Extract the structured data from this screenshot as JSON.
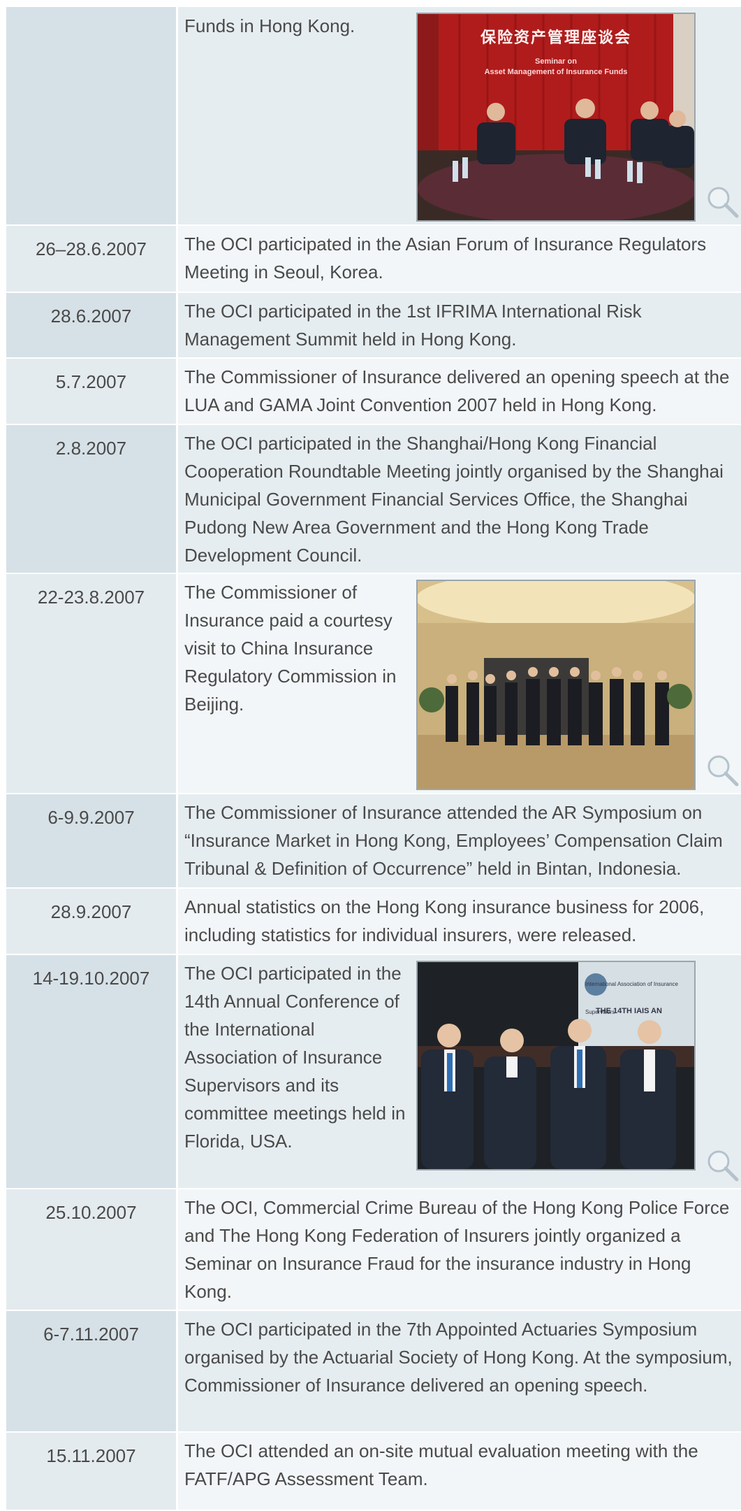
{
  "rows": [
    {
      "date": "",
      "text": "Funds in Hong Kong.",
      "photo": "seminar",
      "banner": {
        "zh": "保险资产管理座谈会",
        "en1": "Seminar on",
        "en2": "Asset Management of Insurance Funds"
      }
    },
    {
      "date": "26–28.6.2007",
      "text": "The OCI participated in the Asian Forum of Insurance Regulators Meeting in Seoul, Korea."
    },
    {
      "date": "28.6.2007",
      "text": "The OCI participated in the 1st IFRIMA International Risk Management Summit held in Hong Kong."
    },
    {
      "date": "5.7.2007",
      "text": "The Commissioner of Insurance delivered an opening speech at the LUA and GAMA Joint Convention 2007 held in Hong Kong."
    },
    {
      "date": "2.8.2007",
      "text": "The OCI participated in the Shanghai/Hong Kong Financial Cooperation Roundtable Meeting jointly organised by the Shanghai Municipal Government Financial Services Office, the Shanghai Pudong New Area Government and the Hong Kong Trade Development Council."
    },
    {
      "date": "22-23.8.2007",
      "text": "The Commissioner of Insurance paid a courtesy visit to China Insurance Regulatory Commission in Beijing.",
      "photo": "group"
    },
    {
      "date": "6-9.9.2007",
      "text": "The Commissioner of Insurance attended the AR Symposium on “Insurance Market in Hong Kong, Employees’ Compensation Claim Tribunal & Definition of Occurrence” held in Bintan, Indonesia."
    },
    {
      "date": "28.9.2007",
      "text": "Annual statistics on the Hong Kong insurance business for 2006, including statistics for individual insurers, were released."
    },
    {
      "date": "14-19.10.2007",
      "text": "The OCI participated in the 14th Annual Conference of the International Association of Insurance Supervisors and its committee meetings held in Florida, USA.",
      "photo": "conference",
      "banner": {
        "en1": "International Association of Insurance Supervisors",
        "en2": "THE 14TH IAIS AN"
      }
    },
    {
      "date": "25.10.2007",
      "text": "The OCI, Commercial Crime Bureau of the Hong Kong Police Force and The Hong Kong Federation of Insurers jointly organized a Seminar on Insurance Fraud for the insurance industry in Hong Kong."
    },
    {
      "date": "6-7.11.2007",
      "text": "The OCI participated in the 7th Appointed Actuaries Symposium organised by the Actuarial Society of Hong Kong.  At the symposium, Commissioner of Insurance delivered an opening speech."
    },
    {
      "date": "15.11.2007",
      "text": "The OCI attended an on-site mutual evaluation meeting with the FATF/APG Assessment Team."
    }
  ]
}
